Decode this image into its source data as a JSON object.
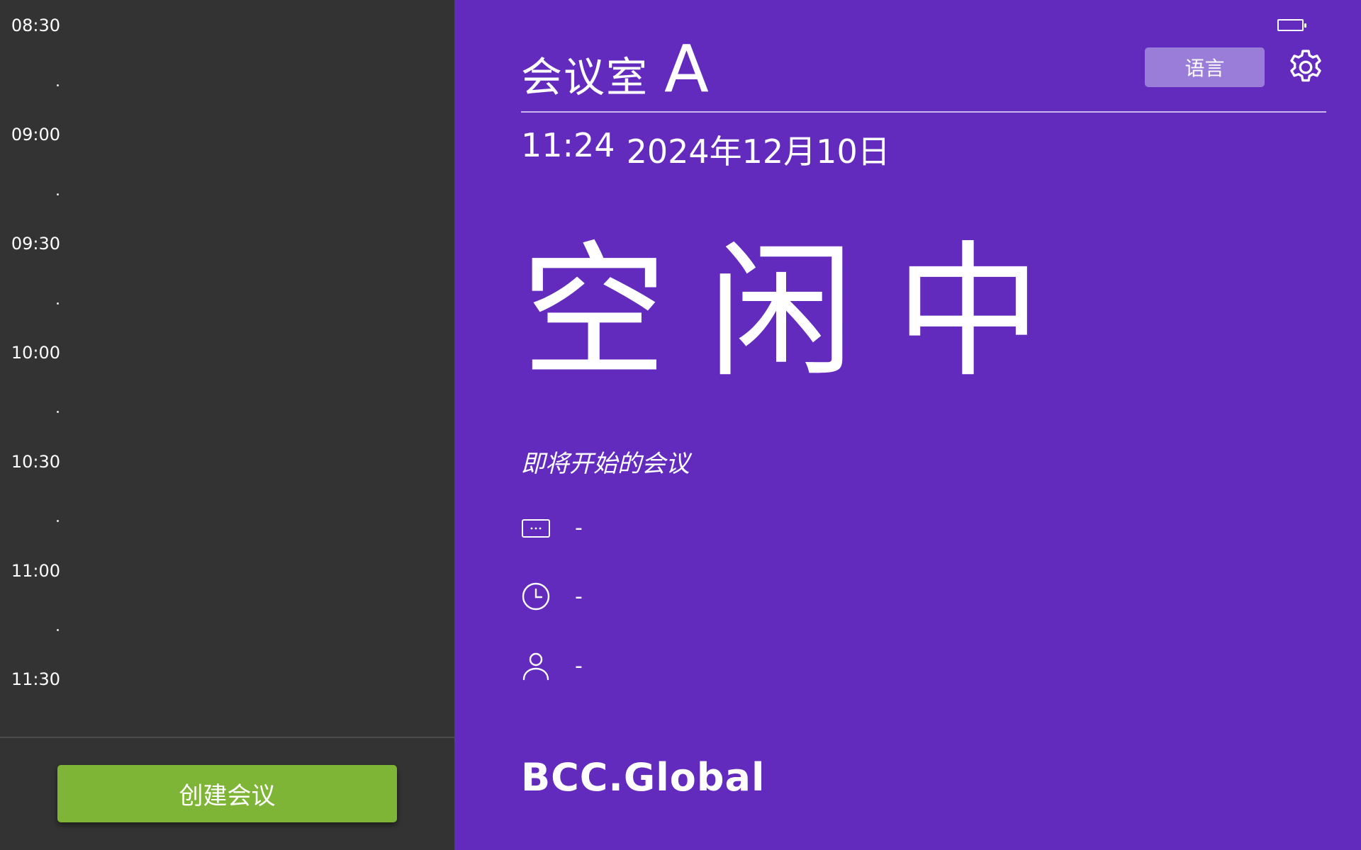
{
  "timeline": {
    "slots": [
      {
        "time": "08:30"
      },
      {
        "time": "09:00"
      },
      {
        "time": "09:30"
      },
      {
        "time": "10:00"
      },
      {
        "time": "10:30"
      },
      {
        "time": "11:00"
      },
      {
        "time": "11:30"
      }
    ]
  },
  "actions": {
    "create_meeting_label": "创建会议"
  },
  "header": {
    "room_name": "会议室",
    "room_letter": "A",
    "language_label": "语言",
    "time": "11:24",
    "date": "2024年12月10日"
  },
  "status": {
    "text": "空闲中"
  },
  "upcoming": {
    "heading": "即将开始的会议",
    "subject": "-",
    "time": "-",
    "organizer": "-"
  },
  "brand": {
    "logo_text": "BCC.Global"
  },
  "colors": {
    "timeline_bg": "#333333",
    "room_bg": "#622abd",
    "create_button": "#7fb536",
    "language_button": "#9a7dd8"
  },
  "icons": {
    "battery": "battery-icon",
    "settings": "gear-icon",
    "subject": "message-icon",
    "time": "clock-icon",
    "organizer": "person-icon"
  }
}
